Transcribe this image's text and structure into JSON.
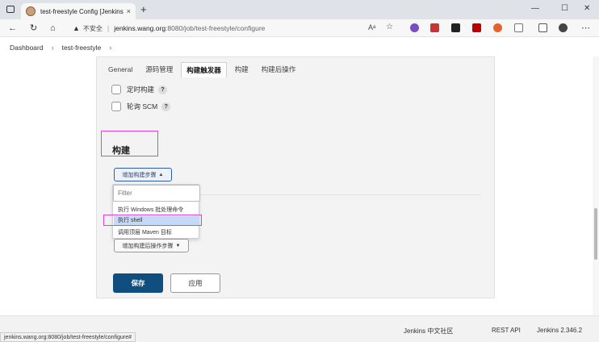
{
  "browser": {
    "tab_title": "test-freestyle Config [Jenkins]",
    "tab_close": "×",
    "new_tab": "+",
    "window_controls": {
      "minimize": "—",
      "maximize": "☐",
      "close": "✕"
    },
    "nav": {
      "back": "←",
      "reload": "↻",
      "home": "⌂"
    },
    "address": {
      "warning_icon": "▲",
      "insecure_label": "不安全",
      "separator": "|",
      "host": "jenkins.wang.org",
      "path": ":8080/job/test-freestyle/configure"
    },
    "read_aloud": "Aᵃ",
    "extension_icons": [
      "shield-ext-icon",
      "badge-ext-icon",
      "dark-ext-icon",
      "ublock-ext-icon",
      "grammarly-ext-icon",
      "brackets-ext-icon",
      "collections-icon",
      "profile-avatar"
    ]
  },
  "breadcrumb": {
    "items": [
      "Dashboard",
      "test-freestyle"
    ],
    "separator": "›"
  },
  "config_tabs": [
    {
      "label": "General",
      "active": false
    },
    {
      "label": "源码管理",
      "active": false
    },
    {
      "label": "构建触发器",
      "active": true
    },
    {
      "label": "构建",
      "active": false
    },
    {
      "label": "构建后操作",
      "active": false
    }
  ],
  "triggers": [
    {
      "label": "定时构建",
      "help": "?"
    },
    {
      "label": "轮询 SCM",
      "help": "?"
    }
  ],
  "build_section": {
    "title": "构建",
    "add_step_button": "增加构建步骤",
    "dropdown_arrow": "▲",
    "filter_placeholder": "Filter",
    "options": [
      "执行 Windows 批处理命令",
      "执行 shell",
      "调用顶层 Maven 目标"
    ],
    "selected_option": "执行 shell"
  },
  "post_build": {
    "button_label": "增加构建后操作步骤",
    "dropdown_arrow": "▼"
  },
  "actions": {
    "save": "保存",
    "apply": "应用"
  },
  "footer": {
    "community": "Jenkins 中文社区",
    "rest_api": "REST API",
    "version": "Jenkins 2.346.2"
  },
  "status_url": "jenkins.wang.org:8080/job/test-freestyle/configure#",
  "colors": {
    "highlight_box": "#e040e0",
    "save_button": "#0f4e7e",
    "selected_option": "#c5d8f5"
  }
}
